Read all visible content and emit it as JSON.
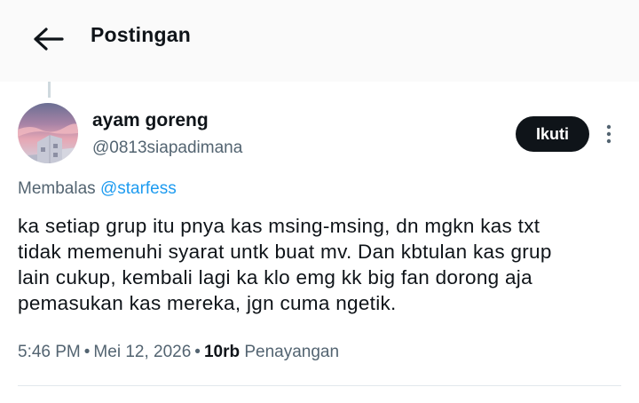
{
  "header": {
    "back_icon": "arrow-left-icon",
    "title": "Postingan"
  },
  "post": {
    "author": {
      "display_name": "ayam goreng",
      "handle": "@0813siapadimana",
      "avatar": "avatar-photo-sunset-building"
    },
    "follow_label": "Ikuti",
    "more_icon": "more-vertical-icon",
    "reply_prefix": "Membalas",
    "reply_to": "@starfess",
    "text_lines": [
      "ka setiap grup itu pnya kas msing-msing, dn mgkn kas txt",
      "tidak memenuhi syarat untk buat mv. Dan kbtulan kas grup",
      "lain cukup, kembali lagi ka klo emg kk big fan dorong aja",
      "pemasukan kas mereka, jgn cuma ngetik."
    ],
    "time": "5:46 PM",
    "separator": "•",
    "date": "Mei 12, 2026",
    "views_count": "10rb",
    "views_label": "Penayangan"
  },
  "colors": {
    "text_primary": "#0f1419",
    "text_secondary": "#536471",
    "link": "#1d9bf0",
    "follow_bg": "#0f1419",
    "header_bg": "#fafafa"
  }
}
